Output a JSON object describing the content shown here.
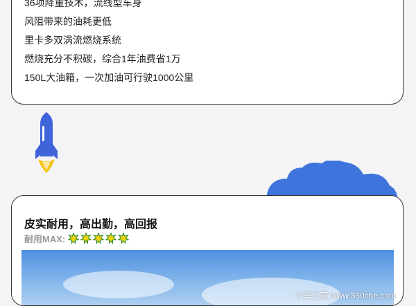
{
  "features": [
    "36项降重技术，流线型车身",
    "风阻带来的油耗更低",
    "里卡多双涡流燃烧系统",
    "燃烧充分不积碳，综合1年油费省1万",
    "150L大油箱，一次加油可行驶1000公里"
  ],
  "section": {
    "title": "皮实耐用，高出勤，高回报",
    "rating_label": "耐用MAX:",
    "rating_value": 5,
    "rating_max": 5
  },
  "watermark": "卡车之家 www.360che.com",
  "colors": {
    "rocket_body": "#3f63d9",
    "rocket_flame": "#f5c518",
    "cloud": "#3f74dc",
    "star_fill": "#f2d20c",
    "star_stroke": "#2b8a2b"
  }
}
